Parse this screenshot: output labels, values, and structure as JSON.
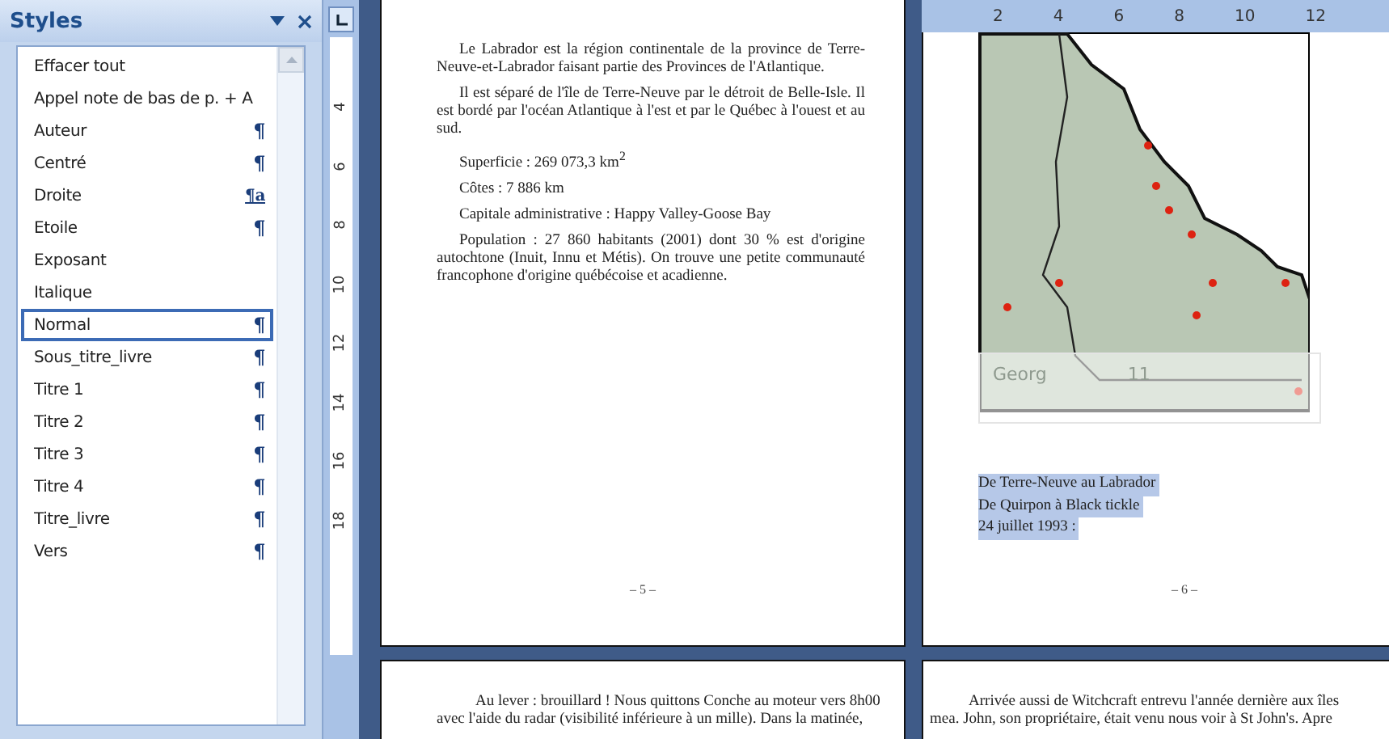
{
  "styles_pane": {
    "title": "Styles",
    "items": [
      {
        "label": "Effacer tout",
        "selected": false
      },
      {
        "label": "Appel note de bas de p. + A",
        "selected": false
      },
      {
        "label": "Auteur",
        "mark": "¶",
        "selected": false
      },
      {
        "label": "Centré",
        "mark": "¶",
        "selected": false
      },
      {
        "label": "Droite",
        "mark": "¶a",
        "selected": false
      },
      {
        "label": "Etoile",
        "mark": "¶",
        "selected": false
      },
      {
        "label": "Exposant",
        "selected": false
      },
      {
        "label": "Italique",
        "selected": false
      },
      {
        "label": "Normal",
        "mark": "¶",
        "selected": true
      },
      {
        "label": "Sous_titre_livre",
        "mark": "¶",
        "selected": false
      },
      {
        "label": "Titre 1",
        "mark": "¶",
        "selected": false
      },
      {
        "label": "Titre 2",
        "mark": "¶",
        "selected": false
      },
      {
        "label": "Titre 3",
        "mark": "¶",
        "selected": false
      },
      {
        "label": "Titre 4",
        "mark": "¶",
        "selected": false
      },
      {
        "label": "Titre_livre",
        "mark": "¶",
        "selected": false
      },
      {
        "label": "Vers",
        "mark": "¶",
        "selected": false
      }
    ]
  },
  "horizontal_ruler": {
    "labels": [
      "2",
      "4",
      "6",
      "8",
      "10",
      "12"
    ]
  },
  "vertical_ruler": {
    "labels": [
      "4",
      "6",
      "8",
      "10",
      "12",
      "14",
      "16",
      "18"
    ]
  },
  "pages": [
    {
      "paragraphs": [
        "Le Labrador est la région continentale de la province de Terre-Neuve-et-Labrador faisant partie des Provinces de l'Atlantique.",
        "Il est séparé de l'île de Terre-Neuve par le détroit de Belle-Isle. Il est bordé par l'océan Atlantique à l'est et par le Québec à l'ouest et au sud.",
        "Superficie : 269 073,3 km$^{2}$",
        "Côtes : 7 886 km",
        "Capitale administrative : Happy Valley-Goose Bay",
        "Population : 27 860 habitants (2001) dont 30 % est d'origine autochtone (Inuit, Innu et Métis). On trouve une petite communauté francophone d'origine québécoise et acadienne."
      ],
      "page_number": "– 5 –"
    },
    {
      "mini_toolbar": {
        "font": "Georg",
        "size": "11"
      },
      "lines": [
        {
          "text": "De Terre-Neuve au Labrador",
          "selected": true
        },
        {
          "text": "De Quirpon à Black tickle",
          "selected": true
        },
        {
          "text": "24 juillet 1993 :",
          "selected": true
        }
      ],
      "page_number": "– 6 –"
    },
    {
      "lines": [
        "Au lever : brouillard ! Nous quittons Conche au moteur vers 8h00",
        "avec l'aide du radar (visibilité inférieure à un mille). Dans la matinée,"
      ]
    },
    {
      "lines": [
        "Arrivée aussi de Witchcraft entrevu l'année dernière aux îles",
        "mea. John, son propriétaire, était venu nous voir à St John's. Apre"
      ]
    }
  ]
}
